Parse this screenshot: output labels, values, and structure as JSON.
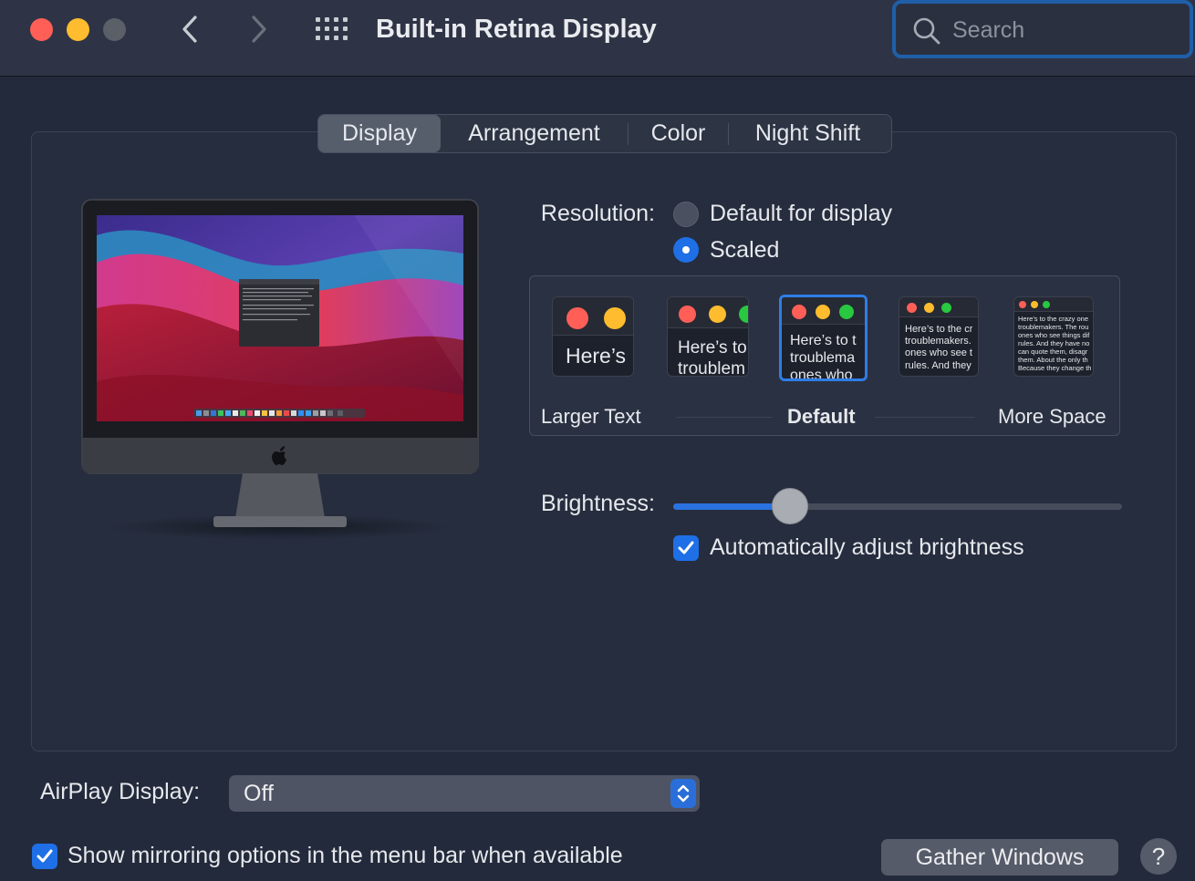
{
  "window": {
    "title": "Built-in Retina Display",
    "search_placeholder": "Search"
  },
  "tabs": [
    {
      "label": "Display",
      "active": true
    },
    {
      "label": "Arrangement",
      "active": false
    },
    {
      "label": "Color",
      "active": false
    },
    {
      "label": "Night Shift",
      "active": false
    }
  ],
  "resolution": {
    "label": "Resolution:",
    "options": [
      {
        "label": "Default for display",
        "selected": false
      },
      {
        "label": "Scaled",
        "selected": true
      }
    ]
  },
  "scaled": {
    "thumbnails": [
      {
        "text": "Here’s",
        "selected": false
      },
      {
        "text": "Here’s to\ntroublem",
        "selected": false
      },
      {
        "text": "Here’s to t\ntroublema\nones who",
        "selected": true
      },
      {
        "text": "Here’s to the cr\ntroublemakers.\nones who see t\nrules. And they",
        "selected": false
      },
      {
        "text": "Here’s to the crazy one\ntroublemakers. The rou\nones who see things dif\nrules. And they have no\ncan quote them, disagr\nthem. About the only th\nBecause they change th",
        "selected": false
      }
    ],
    "labels": {
      "left": "Larger Text",
      "middle": "Default",
      "right": "More Space"
    }
  },
  "brightness": {
    "label": "Brightness:",
    "level": 0.26,
    "auto_label": "Automatically adjust brightness",
    "auto_checked": true
  },
  "airplay": {
    "label": "AirPlay Display:",
    "value": "Off"
  },
  "mirroring": {
    "label": "Show mirroring options in the menu bar when available",
    "checked": true
  },
  "buttons": {
    "gather": "Gather Windows",
    "help": "?"
  },
  "colors": {
    "accent": "#1f6fe6",
    "close": "#ff5f57",
    "minimize": "#febc2e",
    "zoom": "#28c840"
  }
}
